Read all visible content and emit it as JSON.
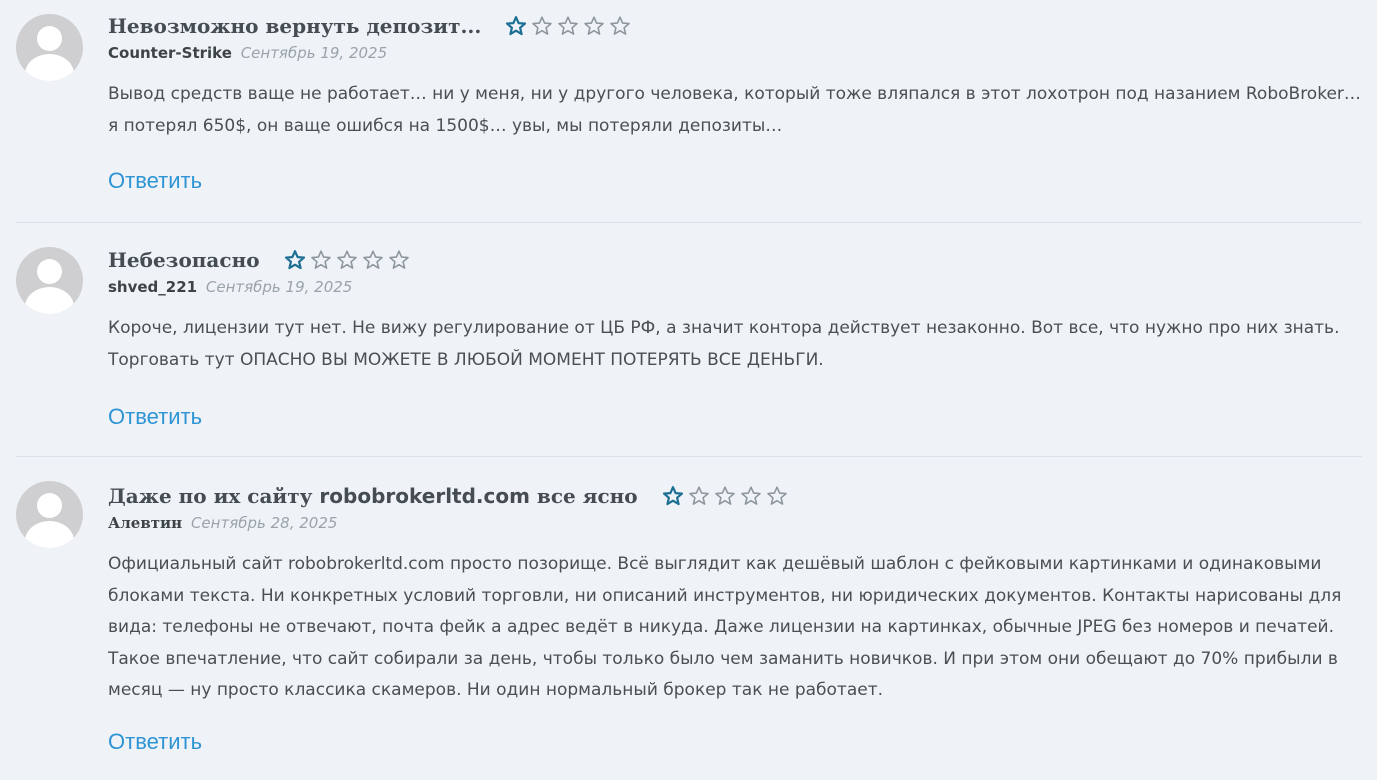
{
  "comments": [
    {
      "title": "Невозможно вернуть депозит...",
      "rating": 1,
      "author": "Counter-Strike",
      "date": "Сентябрь 19, 2025",
      "text": "Вывод средств ваще не работает… ни у меня, ни у другого человека, который тоже вляпался в этот лохотрон под назанием RoboBroker… я потерял 650$, он ваще ошибся на 1500$… увы, мы потеряли депозиты…",
      "reply_label": "Ответить"
    },
    {
      "title": "Небезопасно",
      "rating": 1,
      "author": "shved_221",
      "date": "Сентябрь 19, 2025",
      "text": "Короче, лицензии тут нет. Не вижу регулирование от ЦБ РФ, а значит контора действует незаконно. Вот все, что нужно про них знать. Торговать тут ОПАСНО ВЫ МОЖЕТЕ В ЛЮБОЙ МОМЕНТ ПОТЕРЯТЬ ВСЕ ДЕНЬГИ.",
      "reply_label": "Ответить"
    },
    {
      "title_prefix": "Даже по их сайту ",
      "title_site": "robobrokerltd.com",
      "title_suffix": " все ясно",
      "rating": 1,
      "author": "Алевтин",
      "date": "Сентябрь 28, 2025",
      "text": "Официальный сайт robobrokerltd.com просто позорище. Всё выглядит как дешёвый шаблон с фейковыми картинками и одинаковыми блоками текста. Ни конкретных условий торговли, ни описаний инструментов, ни юридических документов. Контакты нарисованы для вида: телефоны не отвечают, почта фейк а адрес ведёт в никуда. Даже лицензии на картинках, обычные JPEG без номеров и печатей. Такое впечатление, что сайт собирали за день, чтобы только было чем заманить новичков. И при этом они обещают до 70% прибыли в месяц — ну просто классика скамеров. Ни один нормальный брокер так не работает.",
      "reply_label": "Ответить"
    }
  ],
  "rating_max": 5,
  "colors": {
    "background": "#eff3f8",
    "star_filled": "#1d6f93",
    "star_empty": "#8e989c",
    "reply_link": "#2f94d4",
    "date": "#9aa3a8"
  },
  "icons": {
    "avatar": "default-user-avatar-icon",
    "star": "star-outline-icon"
  }
}
